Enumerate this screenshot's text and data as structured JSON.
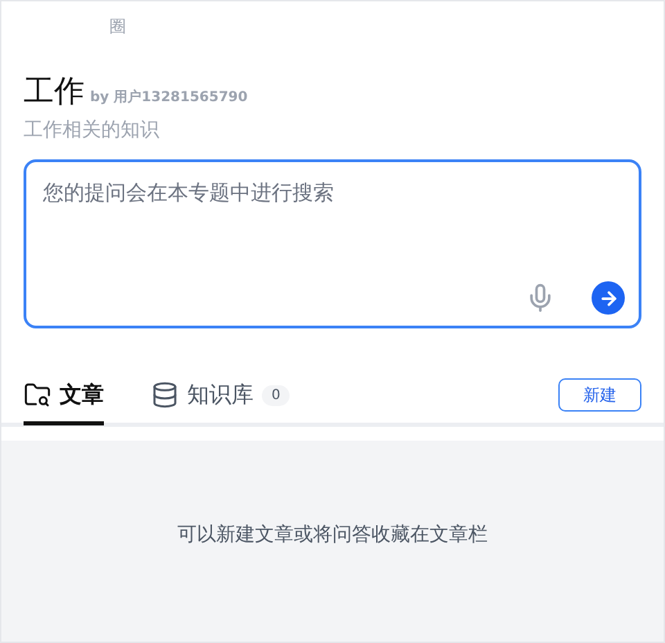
{
  "breadcrumb": "圈",
  "title": "工作",
  "author": "by 用户13281565790",
  "description": "工作相关的知识",
  "search": {
    "placeholder": "您的提问会在本专题中进行搜索"
  },
  "tabs": [
    {
      "label": "文章",
      "kind": "folder",
      "selected": true
    },
    {
      "label": "知识库",
      "kind": "database",
      "count": "0",
      "selected": false
    }
  ],
  "new_button": "新建",
  "empty_message": "可以新建文章或将问答收藏在文章栏"
}
